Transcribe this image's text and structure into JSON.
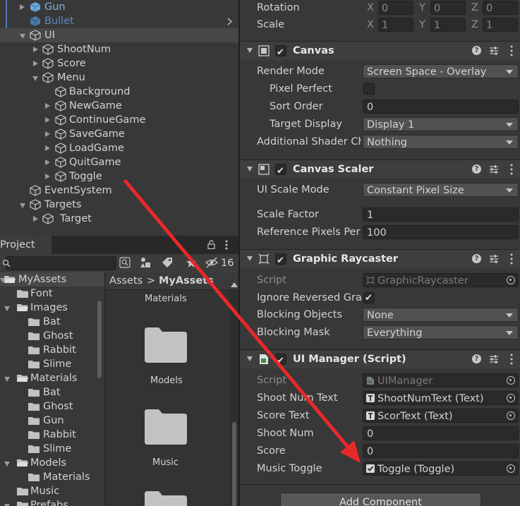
{
  "hierarchy": {
    "items": [
      {
        "label": "Gun",
        "color": "#7cb2e8"
      },
      {
        "label": "Bullet",
        "color": "#5f8bbf"
      },
      {
        "label": "UI"
      },
      {
        "label": "ShootNum"
      },
      {
        "label": "Score"
      },
      {
        "label": "Menu"
      },
      {
        "label": "Background"
      },
      {
        "label": "NewGame"
      },
      {
        "label": "ContinueGame"
      },
      {
        "label": "SaveGame"
      },
      {
        "label": "LoadGame"
      },
      {
        "label": "QuitGame"
      },
      {
        "label": "Toggle"
      },
      {
        "label": "EventSystem"
      },
      {
        "label": "Targets"
      },
      {
        "label": "Target"
      }
    ]
  },
  "project": {
    "tab_label": "Project",
    "hidden_count": "16",
    "search_placeholder": "",
    "tree": [
      {
        "label": "MyAssets"
      },
      {
        "label": "Font"
      },
      {
        "label": "Images"
      },
      {
        "label": "Bat"
      },
      {
        "label": "Ghost"
      },
      {
        "label": "Rabbit"
      },
      {
        "label": "Slime"
      },
      {
        "label": "Materials"
      },
      {
        "label": "Bat"
      },
      {
        "label": "Ghost"
      },
      {
        "label": "Gun"
      },
      {
        "label": "Rabbit"
      },
      {
        "label": "Slime"
      },
      {
        "label": "Models"
      },
      {
        "label": "Materials"
      },
      {
        "label": "Music"
      },
      {
        "label": "Prefabs"
      }
    ],
    "breadcrumb": {
      "root": "Assets",
      "sep": ">",
      "current": "MyAssets"
    },
    "grid": [
      {
        "label": "Materials"
      },
      {
        "label": "Models"
      },
      {
        "label": "Music"
      }
    ]
  },
  "inspector": {
    "transform": {
      "rotation_label": "Rotation",
      "scale_label": "Scale",
      "rotation": {
        "x": "0",
        "y": "0",
        "z": "0"
      },
      "scale": {
        "x": "1",
        "y": "1",
        "z": "1"
      },
      "axes": {
        "x": "X",
        "y": "Y",
        "z": "Z"
      }
    },
    "canvas": {
      "title": "Canvas",
      "render_mode_label": "Render Mode",
      "render_mode": "Screen Space - Overlay",
      "pixel_perfect_label": "Pixel Perfect",
      "sort_order_label": "Sort Order",
      "sort_order": "0",
      "target_display_label": "Target Display",
      "target_display": "Display 1",
      "shader_label": "Additional Shader Ch",
      "shader": "Nothing"
    },
    "canvas_scaler": {
      "title": "Canvas Scaler",
      "mode_label": "UI Scale Mode",
      "mode": "Constant Pixel Size",
      "scale_factor_label": "Scale Factor",
      "scale_factor": "1",
      "ref_ppu_label": "Reference Pixels Per",
      "ref_ppu": "100"
    },
    "raycaster": {
      "title": "Graphic Raycaster",
      "script_label": "Script",
      "script": "GraphicRaycaster",
      "ignore_label": "Ignore Reversed Grap",
      "blocking_objects_label": "Blocking Objects",
      "blocking_objects": "None",
      "blocking_mask_label": "Blocking Mask",
      "blocking_mask": "Everything"
    },
    "ui_manager": {
      "title": "UI Manager (Script)",
      "script_label": "Script",
      "script": "UIManager",
      "shoot_num_text_label": "Shoot Num Text",
      "shoot_num_text": "ShootNumText (Text)",
      "score_text_label": "Score Text",
      "score_text": "ScorText (Text)",
      "shoot_num_label": "Shoot Num",
      "shoot_num": "0",
      "score_label": "Score",
      "score": "0",
      "music_toggle_label": "Music Toggle",
      "music_toggle": "Toggle (Toggle)"
    },
    "add_component_label": "Add Component"
  },
  "colors": {
    "accent_arrow": "#e8282b",
    "selection": "#474747",
    "link_blue": "#7cb2e8"
  }
}
